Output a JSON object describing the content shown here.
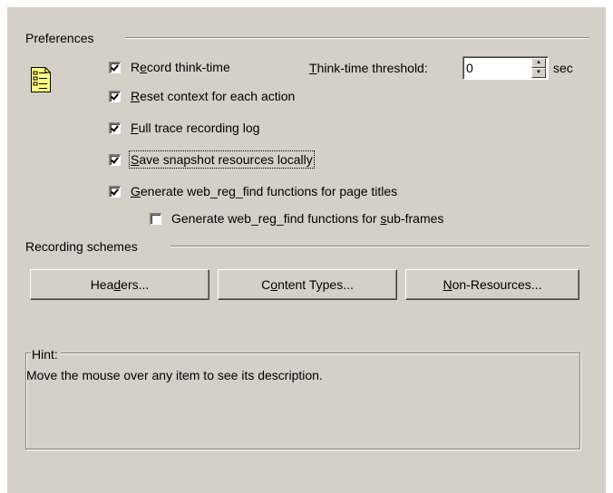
{
  "preferences": {
    "group_label": "Preferences",
    "icon": "document-checklist-icon",
    "record_think_time": {
      "label_pre": "R",
      "label_u": "e",
      "label_post": "cord think-time",
      "checked": true
    },
    "think_time_threshold": {
      "label_u": "T",
      "label_post": "hink-time threshold:",
      "value": "0",
      "unit": "sec"
    },
    "reset_context": {
      "label_u": "R",
      "label_post": "eset context for each action",
      "checked": true
    },
    "full_trace": {
      "label_u": "F",
      "label_post": "ull trace recording log",
      "checked": true
    },
    "save_snapshot": {
      "label_u": "S",
      "label_post": "ave snapshot resources locally",
      "checked": true
    },
    "generate_web_reg_find": {
      "label_u": "G",
      "label_post": "enerate web_reg_find functions for page titles",
      "checked": true
    },
    "generate_sub_frames": {
      "label_pre": "Generate web_reg_find functions for ",
      "label_u": "s",
      "label_post": "ub-frames",
      "checked": false
    }
  },
  "recording_schemes": {
    "group_label": "Recording schemes",
    "headers_button": {
      "pre": "Hea",
      "u": "d",
      "post": "ers..."
    },
    "content_types_button": {
      "pre": "C",
      "u": "o",
      "post": "ntent Types..."
    },
    "non_resources_button": {
      "pre": "",
      "u": "N",
      "post": "on-Resources..."
    }
  },
  "hint": {
    "group_label": "Hint:",
    "text": "Move the mouse over any item to see its description."
  }
}
